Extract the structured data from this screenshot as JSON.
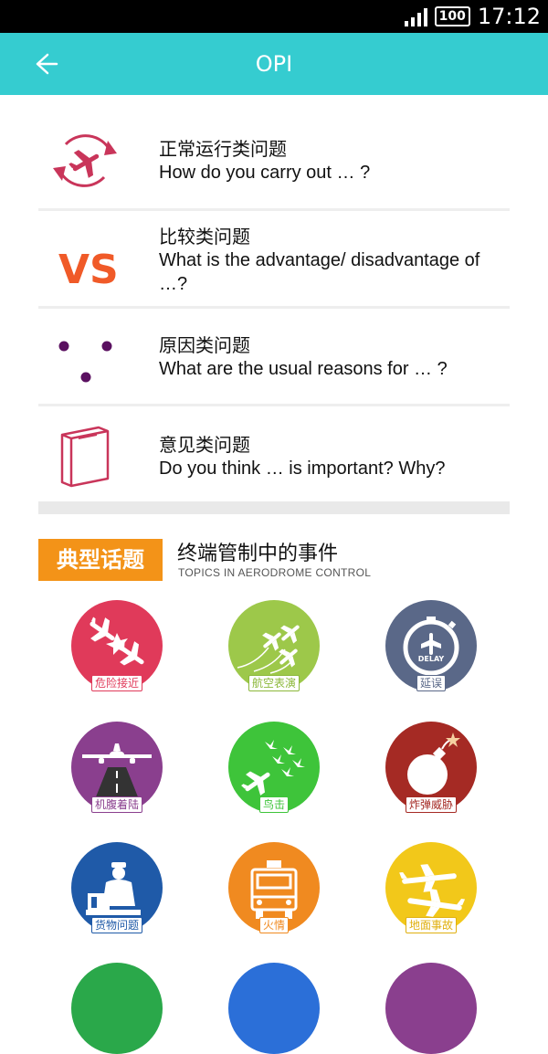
{
  "status_bar": {
    "battery": "100",
    "time": "17:12"
  },
  "app_bar": {
    "title": "OPI"
  },
  "questions": [
    {
      "cn": "正常运行类问题",
      "en": "How do you carry out … ?",
      "icon": "plane-cycle-icon"
    },
    {
      "cn": "比较类问题",
      "en": "What is the advantage/ disadvantage of …?",
      "icon": "vs-icon"
    },
    {
      "cn": "原因类问题",
      "en": "What are the usual reasons for … ?",
      "icon": "dots-icon"
    },
    {
      "cn": "意见类问题",
      "en": "Do you think … is important? Why?",
      "icon": "ballot-box-icon"
    }
  ],
  "topics_header": {
    "tag": "典型话题",
    "title": "终端管制中的事件",
    "subtitle": "TOPICS IN AERODROME CONTROL"
  },
  "topics": [
    {
      "label": "危险接近",
      "color": "#e03a5a",
      "icon": "near-miss-icon"
    },
    {
      "label": "航空表演",
      "color": "#9dc84a",
      "icon": "airshow-icon"
    },
    {
      "label": "延误",
      "color": "#5a6888",
      "icon": "delay-stopwatch-icon",
      "inner_text": "DELAY"
    },
    {
      "label": "机腹着陆",
      "color": "#8a3f8e",
      "icon": "belly-landing-icon"
    },
    {
      "label": "鸟击",
      "color": "#3ec43a",
      "icon": "bird-strike-icon"
    },
    {
      "label": "炸弹威胁",
      "color": "#a52a24",
      "icon": "bomb-icon"
    },
    {
      "label": "货物问题",
      "color": "#1f5aa8",
      "icon": "cargo-icon"
    },
    {
      "label": "火情",
      "color": "#f08a20",
      "icon": "fire-truck-icon"
    },
    {
      "label": "地面事故",
      "color": "#f2c81a",
      "icon": "ground-incident-icon"
    }
  ],
  "colors": {
    "app_bar": "#35ccd0",
    "topic_tag": "#f39318"
  }
}
